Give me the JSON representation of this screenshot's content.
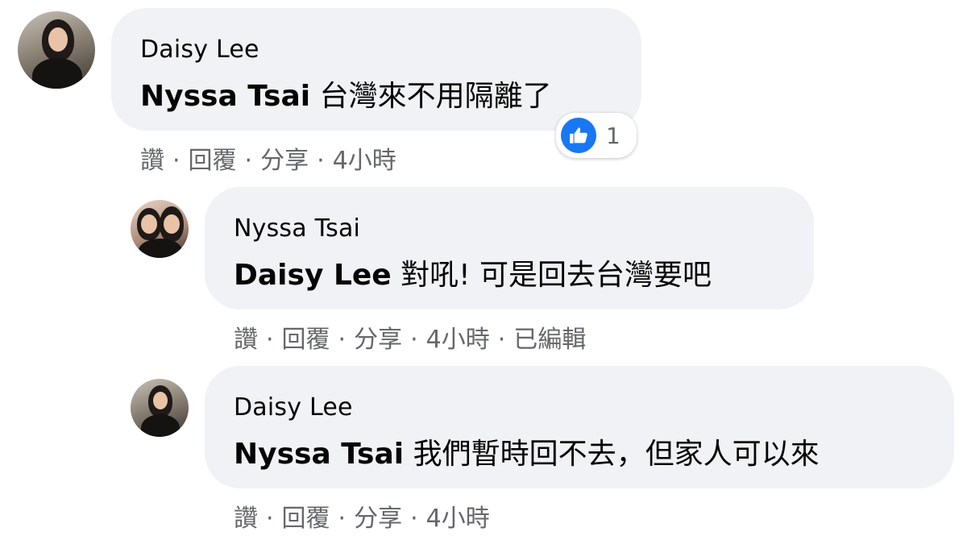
{
  "comments": [
    {
      "author": "Daisy Lee",
      "mention": "Nyssa Tsai",
      "text": "台灣來不用隔離了",
      "actions": {
        "like": "讚",
        "reply": "回覆",
        "share": "分享",
        "time": "4小時",
        "edited": ""
      },
      "reaction": {
        "icon": "thumbs-up-icon",
        "count": "1",
        "color": "#1877f2"
      }
    },
    {
      "author": "Nyssa Tsai",
      "mention": "Daisy Lee",
      "text": "對吼! 可是回去台灣要吧",
      "actions": {
        "like": "讚",
        "reply": "回覆",
        "share": "分享",
        "time": "4小時",
        "edited": "已編輯"
      }
    },
    {
      "author": "Daisy Lee",
      "mention": "Nyssa Tsai",
      "text": "我們暫時回不去，但家人可以來",
      "actions": {
        "like": "讚",
        "reply": "回覆",
        "share": "分享",
        "time": "4小時",
        "edited": ""
      }
    }
  ],
  "separator": "·",
  "colors": {
    "bubble": "#f0f2f5",
    "meta_text": "#65676b",
    "like_blue": "#1877f2"
  }
}
